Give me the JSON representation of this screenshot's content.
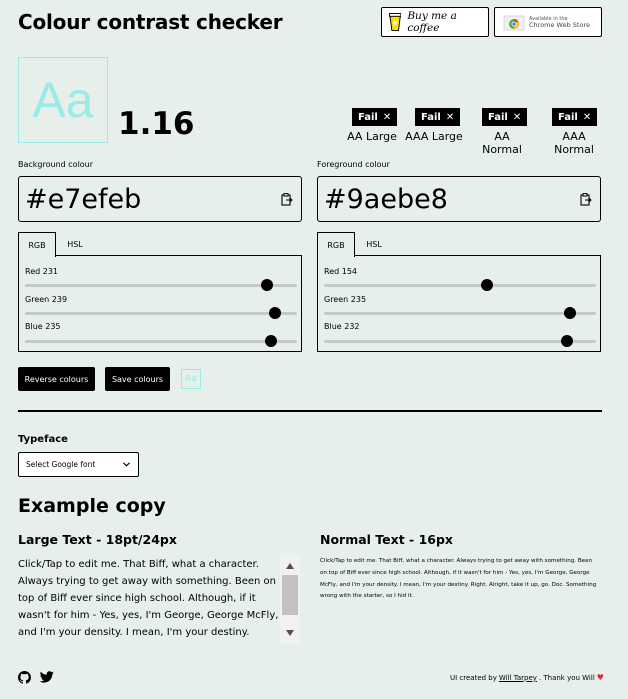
{
  "header": {
    "title": "Colour contrast checker",
    "coffee_label": "Buy me a coffee",
    "cws_small": "Available in the",
    "cws_big": "Chrome Web Store"
  },
  "preview": {
    "sample": "Aa",
    "ratio": "1.16"
  },
  "results": [
    {
      "status": "Fail",
      "icon": "close-icon",
      "label": "AA Large"
    },
    {
      "status": "Fail",
      "icon": "close-icon",
      "label": "AAA Large"
    },
    {
      "status": "Fail",
      "icon": "close-icon",
      "label": "AA Normal"
    },
    {
      "status": "Fail",
      "icon": "close-icon",
      "label": "AAA Normal"
    }
  ],
  "background": {
    "label": "Background colour",
    "hex": "#e7efeb",
    "tabs": [
      "RGB",
      "HSL"
    ],
    "active_tab": "RGB",
    "sliders": [
      {
        "label": "Red 231",
        "value": 231
      },
      {
        "label": "Green 239",
        "value": 239
      },
      {
        "label": "Blue 235",
        "value": 235
      }
    ]
  },
  "foreground": {
    "label": "Foreground colour",
    "hex": "#9aebe8",
    "tabs": [
      "RGB",
      "HSL"
    ],
    "active_tab": "RGB",
    "sliders": [
      {
        "label": "Red 154",
        "value": 154
      },
      {
        "label": "Green 235",
        "value": 235
      },
      {
        "label": "Blue 232",
        "value": 232
      }
    ]
  },
  "actions": {
    "reverse_label": "Reverse colours",
    "save_label": "Save colours",
    "saved_sample": "Aa"
  },
  "typeface": {
    "label": "Typeface",
    "select_value": "Select Google font"
  },
  "example": {
    "title": "Example copy",
    "large_title": "Large Text - 18pt/24px",
    "normal_title": "Normal Text - 16px",
    "large_copy": "Click/Tap to edit me. That Biff, what a character. Always trying to get away with something. Been on top of Biff ever since high school. Although, if it wasn't for him - Yes, yes, I'm George, George McFly, and I'm your density. I mean, I'm your destiny. Right. Alright, take it up, go. Doc.",
    "normal_copy": "Click/Tap to edit me. That Biff, what a character. Always trying to get away with something. Been on top of Biff ever since high school. Although, if it wasn't for him - Yes, yes, I'm George, George McFly, and I'm your density. I mean, I'm your destiny. Right. Alright, take it up, go. Doc. Something wrong with the starter, so I hid it."
  },
  "footer": {
    "credit_prefix": "UI created by",
    "credit_name": "Will Tarpey",
    "credit_suffix": ". Thank you Will",
    "heart_color": "#e0263a"
  },
  "colors": {
    "background": "#e7efeb",
    "foreground": "#9aebe8"
  }
}
